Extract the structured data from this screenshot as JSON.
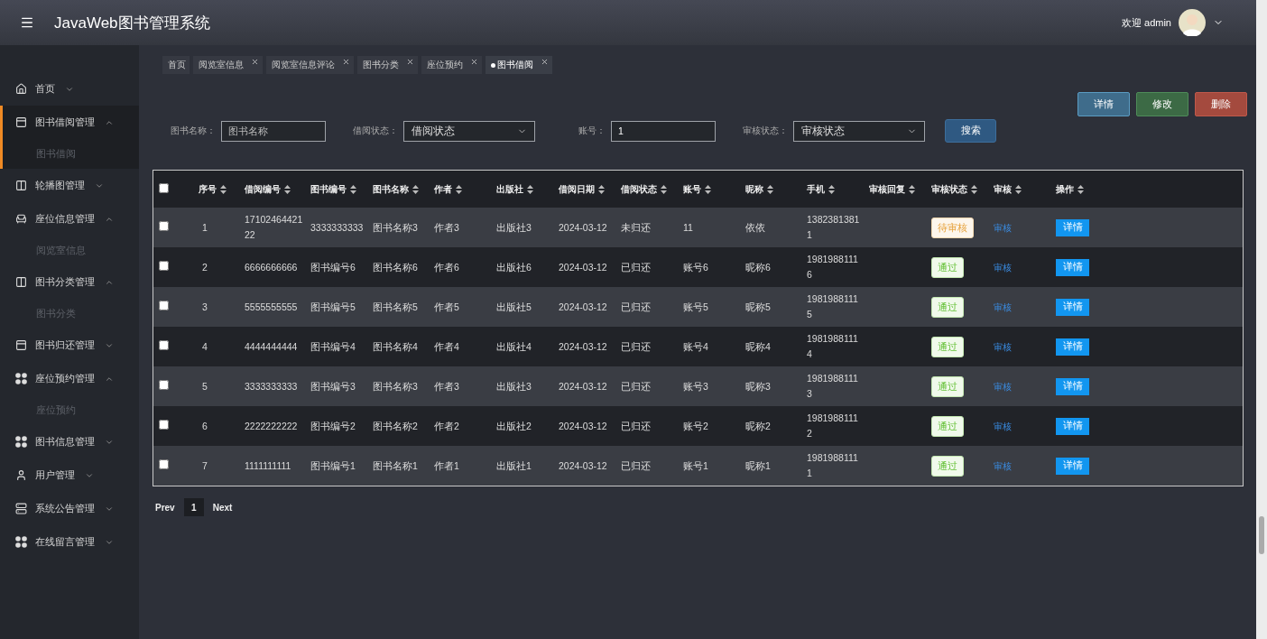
{
  "header": {
    "title": "JavaWeb图书管理系统",
    "welcome": "欢迎 admin"
  },
  "sidebar": {
    "items": [
      {
        "label": "首页",
        "expanded": false,
        "selected": false
      },
      {
        "label": "图书借阅管理",
        "expanded": true,
        "selected": true,
        "children": [
          {
            "label": "图书借阅"
          }
        ]
      },
      {
        "label": "轮播图管理",
        "expanded": false,
        "selected": false
      },
      {
        "label": "座位信息管理",
        "expanded": true,
        "selected": false,
        "children": [
          {
            "label": "阅览室信息"
          }
        ]
      },
      {
        "label": "图书分类管理",
        "expanded": true,
        "selected": false,
        "children": [
          {
            "label": "图书分类"
          }
        ]
      },
      {
        "label": "图书归还管理",
        "expanded": false,
        "selected": false
      },
      {
        "label": "座位预约管理",
        "expanded": true,
        "selected": false,
        "children": [
          {
            "label": "座位预约"
          }
        ]
      },
      {
        "label": "图书信息管理",
        "expanded": false,
        "selected": false
      },
      {
        "label": "用户管理",
        "expanded": false,
        "selected": false
      },
      {
        "label": "系统公告管理",
        "expanded": false,
        "selected": false
      },
      {
        "label": "在线留言管理",
        "expanded": false,
        "selected": false
      }
    ]
  },
  "tabs": [
    {
      "label": "首页",
      "closable": false,
      "selected": false
    },
    {
      "label": "阅览室信息",
      "closable": true,
      "selected": false
    },
    {
      "label": "阅览室信息评论",
      "closable": true,
      "selected": false
    },
    {
      "label": "图书分类",
      "closable": true,
      "selected": false
    },
    {
      "label": "座位预约",
      "closable": true,
      "selected": false
    },
    {
      "label": "图书借阅",
      "closable": true,
      "selected": true
    }
  ],
  "actions": [
    {
      "label": "详情",
      "kind": "info"
    },
    {
      "label": "修改",
      "kind": "edit"
    },
    {
      "label": "删除",
      "kind": "delete"
    }
  ],
  "filters": [
    {
      "label": "图书名称：",
      "kind": "input",
      "placeholder": "图书名称"
    },
    {
      "label": "借阅状态：",
      "kind": "select",
      "value": "借阅状态"
    },
    {
      "label": "账号：",
      "kind": "input",
      "value": "1"
    },
    {
      "label": "审核状态：",
      "kind": "select",
      "value": "审核状态"
    }
  ],
  "search_button": "搜索",
  "table": {
    "all_checked": false,
    "columns": [
      {
        "label": "序号",
        "sortable": true
      },
      {
        "label": "借阅编号",
        "sortable": true
      },
      {
        "label": "图书编号",
        "sortable": true
      },
      {
        "label": "图书名称",
        "sortable": true
      },
      {
        "label": "作者",
        "sortable": true
      },
      {
        "label": "出版社",
        "sortable": true
      },
      {
        "label": "借阅日期",
        "sortable": true
      },
      {
        "label": "借阅状态",
        "sortable": true
      },
      {
        "label": "账号",
        "sortable": true
      },
      {
        "label": "昵称",
        "sortable": true
      },
      {
        "label": "手机",
        "sortable": true
      },
      {
        "label": "审核回复",
        "sortable": true
      },
      {
        "label": "审核状态",
        "sortable": true
      },
      {
        "label": "审核",
        "sortable": true
      },
      {
        "label": "操作",
        "sortable": true
      }
    ],
    "rows": [
      {
        "checked": false,
        "cells": [
          "1",
          "1710246442122",
          "3333333333",
          "图书名称3",
          "作者3",
          "出版社3",
          "2024-03-12",
          "未归还",
          "11",
          "依依",
          "13823813811",
          ""
        ],
        "status": {
          "label": "待审核",
          "kind": "pending"
        },
        "review": "审核",
        "detail": "详情"
      },
      {
        "checked": false,
        "cells": [
          "2",
          "6666666666",
          "图书编号6",
          "图书名称6",
          "作者6",
          "出版社6",
          "2024-03-12",
          "已归还",
          "账号6",
          "昵称6",
          "19819881116",
          ""
        ],
        "status": {
          "label": "通过",
          "kind": "passed"
        },
        "review": "审核",
        "detail": "详情"
      },
      {
        "checked": false,
        "cells": [
          "3",
          "5555555555",
          "图书编号5",
          "图书名称5",
          "作者5",
          "出版社5",
          "2024-03-12",
          "已归还",
          "账号5",
          "昵称5",
          "19819881115",
          ""
        ],
        "status": {
          "label": "通过",
          "kind": "passed"
        },
        "review": "审核",
        "detail": "详情"
      },
      {
        "checked": false,
        "cells": [
          "4",
          "4444444444",
          "图书编号4",
          "图书名称4",
          "作者4",
          "出版社4",
          "2024-03-12",
          "已归还",
          "账号4",
          "昵称4",
          "19819881114",
          ""
        ],
        "status": {
          "label": "通过",
          "kind": "passed"
        },
        "review": "审核",
        "detail": "详情"
      },
      {
        "checked": false,
        "cells": [
          "5",
          "3333333333",
          "图书编号3",
          "图书名称3",
          "作者3",
          "出版社3",
          "2024-03-12",
          "已归还",
          "账号3",
          "昵称3",
          "19819881113",
          ""
        ],
        "status": {
          "label": "通过",
          "kind": "passed"
        },
        "review": "审核",
        "detail": "详情"
      },
      {
        "checked": false,
        "cells": [
          "6",
          "2222222222",
          "图书编号2",
          "图书名称2",
          "作者2",
          "出版社2",
          "2024-03-12",
          "已归还",
          "账号2",
          "昵称2",
          "19819881112",
          ""
        ],
        "status": {
          "label": "通过",
          "kind": "passed"
        },
        "review": "审核",
        "detail": "详情"
      },
      {
        "checked": false,
        "cells": [
          "7",
          "1111111111",
          "图书编号1",
          "图书名称1",
          "作者1",
          "出版社1",
          "2024-03-12",
          "已归还",
          "账号1",
          "昵称1",
          "19819881111",
          ""
        ],
        "status": {
          "label": "通过",
          "kind": "passed"
        },
        "review": "审核",
        "detail": "详情"
      }
    ]
  },
  "pagination": {
    "prev": "Prev",
    "next": "Next",
    "pages": [
      {
        "label": "1",
        "selected": true
      }
    ]
  }
}
